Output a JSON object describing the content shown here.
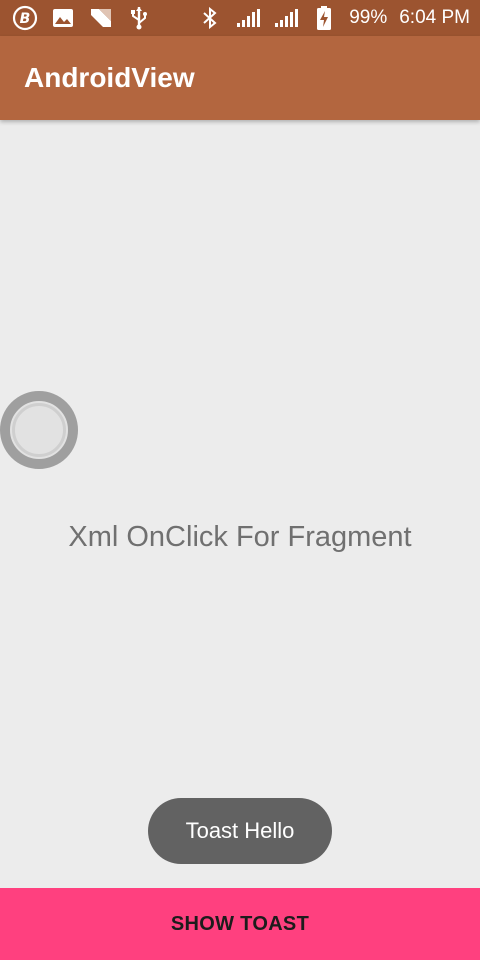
{
  "status_bar": {
    "left_icons": [
      "b-circle-icon",
      "image-icon",
      "n-logo-icon",
      "usb-icon"
    ],
    "right_icons": [
      "bluetooth-icon",
      "signal-icon",
      "signal-icon",
      "battery-charging-icon"
    ],
    "battery": "99%",
    "time": "6:04 PM"
  },
  "app_bar": {
    "title": "AndroidView"
  },
  "content": {
    "label": "Xml OnClick For Fragment"
  },
  "toast": {
    "text": "Toast Hello"
  },
  "button": {
    "label": "SHOW TOAST"
  },
  "colors": {
    "status_bar": "#9c5430",
    "app_bar": "#b3663f",
    "background": "#ececec",
    "button": "#ff407f",
    "toast": "#626262"
  }
}
